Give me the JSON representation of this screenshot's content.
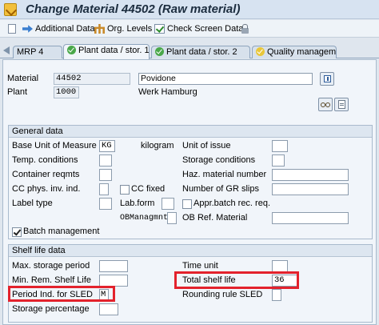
{
  "window": {
    "title": "Change Material 44502 (Raw material)"
  },
  "toolbar": {
    "additional_data": "Additional Data",
    "org_levels": "Org. Levels",
    "check_screen_data": "Check Screen Data"
  },
  "tabs": [
    {
      "label": "MRP 4",
      "active": false
    },
    {
      "label": "Plant data / stor. 1",
      "active": true
    },
    {
      "label": "Plant data / stor. 2",
      "active": false
    },
    {
      "label": "Quality managem...",
      "active": false
    }
  ],
  "header": {
    "material_label": "Material",
    "material_value": "44502",
    "material_desc": "Povidone",
    "plant_label": "Plant",
    "plant_value": "1000",
    "plant_desc": "Werk Hamburg"
  },
  "general": {
    "title": "General data",
    "base_uom_label": "Base Unit of Measure",
    "base_uom_value": "KG",
    "base_uom_text": "kilogram",
    "unit_of_issue_label": "Unit of issue",
    "temp_conditions_label": "Temp. conditions",
    "storage_conditions_label": "Storage conditions",
    "container_reqmts_label": "Container reqmts",
    "haz_material_label": "Haz. material number",
    "cc_phys_inv_label": "CC phys. inv. ind.",
    "cc_fixed_label": "CC fixed",
    "gr_slips_label": "Number of GR slips",
    "label_type_label": "Label type",
    "lab_form_label": "Lab.form",
    "appr_batch_label": "Appr.batch rec. req.",
    "ob_managmnt_label": "OBManagmnt",
    "ob_ref_material_label": "OB Ref. Material",
    "batch_management_label": "Batch management",
    "batch_management_checked": true
  },
  "shelf": {
    "title": "Shelf life data",
    "max_storage_label": "Max. storage period",
    "time_unit_label": "Time unit",
    "min_rem_label": "Min. Rem. Shelf Life",
    "total_shelf_label": "Total shelf life",
    "total_shelf_value": "36",
    "period_ind_label": "Period Ind. for SLED",
    "period_ind_value": "M",
    "rounding_rule_label": "Rounding rule SLED",
    "storage_pct_label": "Storage percentage"
  },
  "colors": {
    "highlight": "#e3222c",
    "title_bar": "#d7e3f1"
  }
}
